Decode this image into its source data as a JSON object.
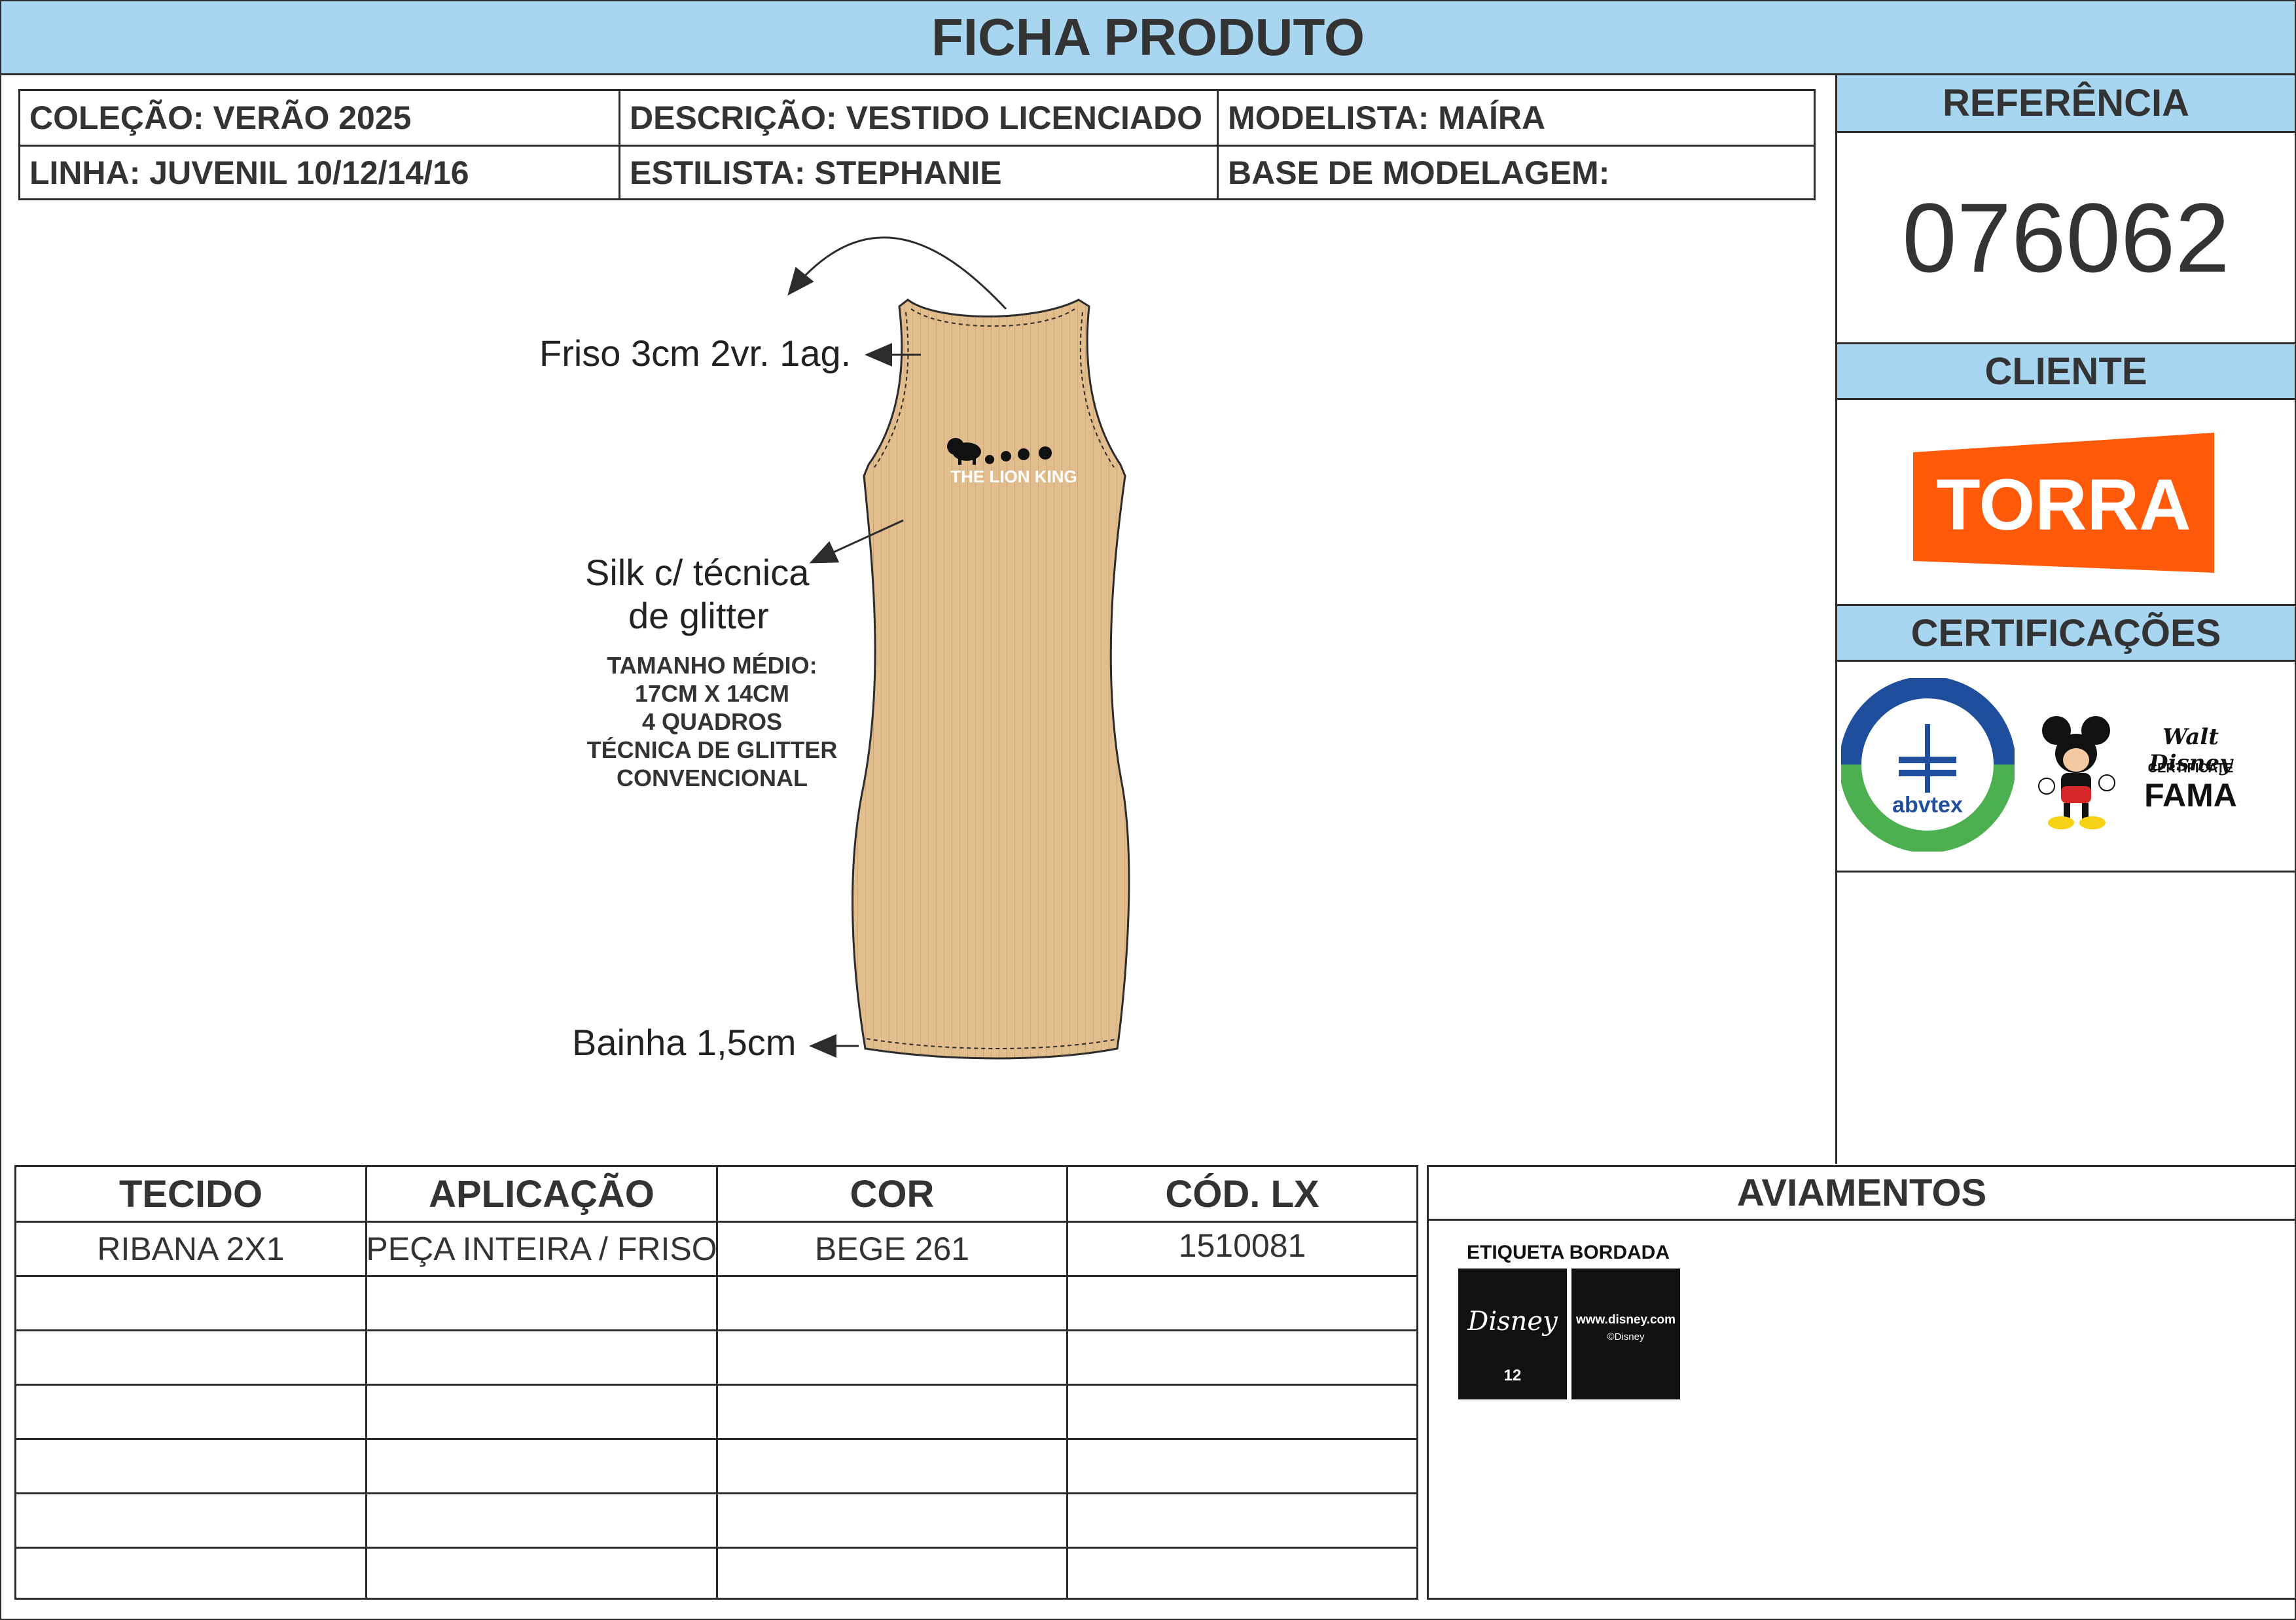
{
  "title": "FICHA PRODUTO",
  "info": {
    "colecao": "COLEÇÃO: VERÃO 2025",
    "descricao": "DESCRIÇÃO: VESTIDO LICENCIADO",
    "modelista": "MODELISTA: MAÍRA",
    "linha": "LINHA: JUVENIL 10/12/14/16",
    "estilista": "ESTILISTA: STEPHANIE",
    "base": "BASE DE MODELAGEM:"
  },
  "sidebar": {
    "referencia_label": "REFERÊNCIA",
    "referencia_value": "076062",
    "cliente_label": "CLIENTE",
    "cliente_logo_text": "TORRA",
    "certificacoes_label": "CERTIFICAÇÕES",
    "abvtex_text": "abvtex",
    "disney_cert_text": "CERTIFICATE",
    "fama_text": "FAMA"
  },
  "sketch": {
    "print_text": "THE LION KING",
    "callout_friso": "Friso 3cm 2vr. 1ag.",
    "callout_silk_1": "Silk c/ técnica",
    "callout_silk_2": "de glitter",
    "note_lines": [
      "TAMANHO MÉDIO:",
      "17CM X 14CM",
      "4 QUADROS",
      "TÉCNICA DE GLITTER",
      "CONVENCIONAL"
    ],
    "callout_bainha": "Bainha 1,5cm",
    "garment_color": "#e2bd8d"
  },
  "materials": {
    "headers": [
      "TECIDO",
      "APLICAÇÃO",
      "COR",
      "CÓD. LX"
    ],
    "rows": [
      [
        "RIBANA 2X1",
        "PEÇA INTEIRA / FRISO",
        "BEGE 261",
        "1510081"
      ]
    ]
  },
  "aviamentos": {
    "title": "AVIAMENTOS",
    "item_label": "ETIQUETA BORDADA",
    "tag_size": "12",
    "tag_url": "www.disney.com",
    "tag_copyright": "©Disney"
  },
  "colors": {
    "header_blue": "#a8d5ef",
    "torra_orange": "#ff5a0a"
  }
}
